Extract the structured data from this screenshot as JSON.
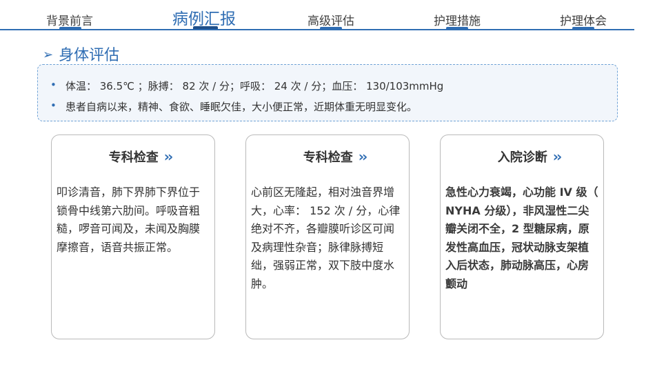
{
  "nav": {
    "items": [
      {
        "label": "背景前言",
        "active": false
      },
      {
        "label": "病例汇报",
        "active": true
      },
      {
        "label": "高级评估",
        "active": false
      },
      {
        "label": "护理措施",
        "active": false
      },
      {
        "label": "护理体会",
        "active": false
      }
    ]
  },
  "section": {
    "arrow": "➢",
    "title": "身体评估"
  },
  "summary": {
    "bullet": "•",
    "lines": [
      "体温： 36.5℃ ；脉搏： 82 次 / 分；呼吸： 24 次 / 分；血压： 130/103mmHg",
      "患者自病以来，精神、食欲、睡眠欠佳，大小便正常，近期体重无明显变化。"
    ]
  },
  "cards": [
    {
      "title": "专科检查",
      "chevron": "››",
      "body": "叩诊清音，肺下界肺下界位于锁骨中线第六肋间。呼吸音粗糙，啰音可闻及，未闻及胸膜摩擦音，语音共振正常。"
    },
    {
      "title": "专科检查",
      "chevron": "››",
      "body": "心前区无隆起，相对浊音界增大，心率： 152 次 / 分，心律绝对不齐，各瓣膜听诊区可闻及病理性杂音；脉律脉搏短绌，强弱正常，双下肢中度水肿。"
    },
    {
      "title": "入院诊断",
      "chevron": "››",
      "body": "急性心力衰竭，心功能 IV 级（ NYHA 分级），非风湿性二尖瓣关闭不全，2 型糖尿病，原发性高血压，冠状动脉支架植入后状态，肺动脉高压，心房颤动"
    }
  ]
}
